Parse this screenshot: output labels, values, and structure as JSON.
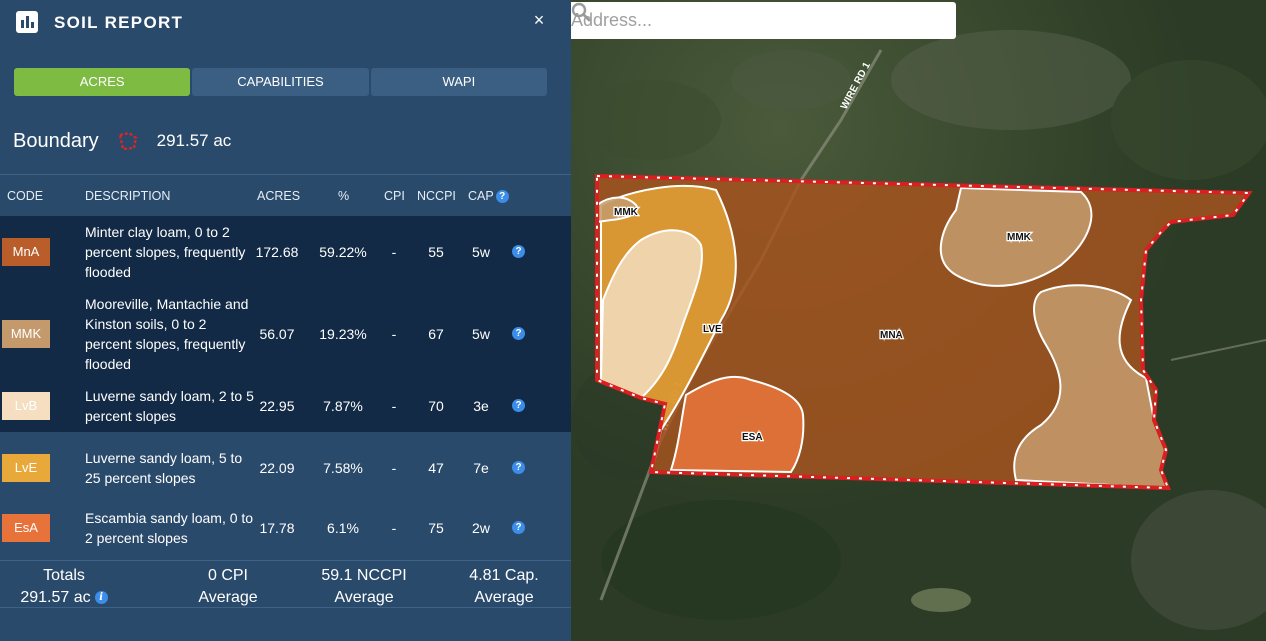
{
  "panel": {
    "title": "SOIL REPORT",
    "close_label": "×",
    "tabs": [
      {
        "label": "ACRES",
        "active": true
      },
      {
        "label": "CAPABILITIES",
        "active": false
      },
      {
        "label": "WAPI",
        "active": false
      }
    ],
    "boundary": {
      "label": "Boundary",
      "value": "291.57 ac"
    }
  },
  "table": {
    "headers": {
      "code": "CODE",
      "description": "DESCRIPTION",
      "acres": "ACRES",
      "percent": "%",
      "cpi": "CPI",
      "nccpi": "NCCPI",
      "cap": "CAP"
    },
    "rows": [
      {
        "code": "MnA",
        "color": "#b95d2b",
        "description": "Minter clay loam, 0 to 2 percent slopes, frequently flooded",
        "acres": "172.68",
        "percent": "59.22%",
        "cpi": "-",
        "nccpi": "55",
        "cap": "5w"
      },
      {
        "code": "MMK",
        "color": "#c49a6c",
        "description": "Mooreville, Mantachie and Kinston soils, 0 to 2 percent slopes, frequently flooded",
        "acres": "56.07",
        "percent": "19.23%",
        "cpi": "-",
        "nccpi": "67",
        "cap": "5w"
      },
      {
        "code": "LvB",
        "color": "#f5dfc0",
        "description": "Luverne sandy loam, 2 to 5 percent slopes",
        "acres": "22.95",
        "percent": "7.87%",
        "cpi": "-",
        "nccpi": "70",
        "cap": "3e"
      },
      {
        "code": "LvE",
        "color": "#e9a93a",
        "description": "Luverne sandy loam, 5 to 25 percent slopes",
        "acres": "22.09",
        "percent": "7.58%",
        "cpi": "-",
        "nccpi": "47",
        "cap": "7e"
      },
      {
        "code": "EsA",
        "color": "#e8733a",
        "description": "Escambia sandy loam, 0 to 2 percent slopes",
        "acres": "17.78",
        "percent": "6.1%",
        "cpi": "-",
        "nccpi": "75",
        "cap": "2w"
      }
    ]
  },
  "footer": {
    "totals_label": "Totals",
    "totals_value": "291.57 ac",
    "cpi_value": "0 CPI",
    "cpi_label": "Average",
    "nccpi_value": "59.1 NCCPI",
    "nccpi_label": "Average",
    "cap_value": "4.81 Cap.",
    "cap_label": "Average"
  },
  "map": {
    "search_placeholder": "Address...",
    "labels": [
      "MMK",
      "MMK",
      "LVE",
      "MNA",
      "ESA"
    ],
    "road_label": "WIRE RD 1",
    "boundary_color": "#d91f1f"
  }
}
